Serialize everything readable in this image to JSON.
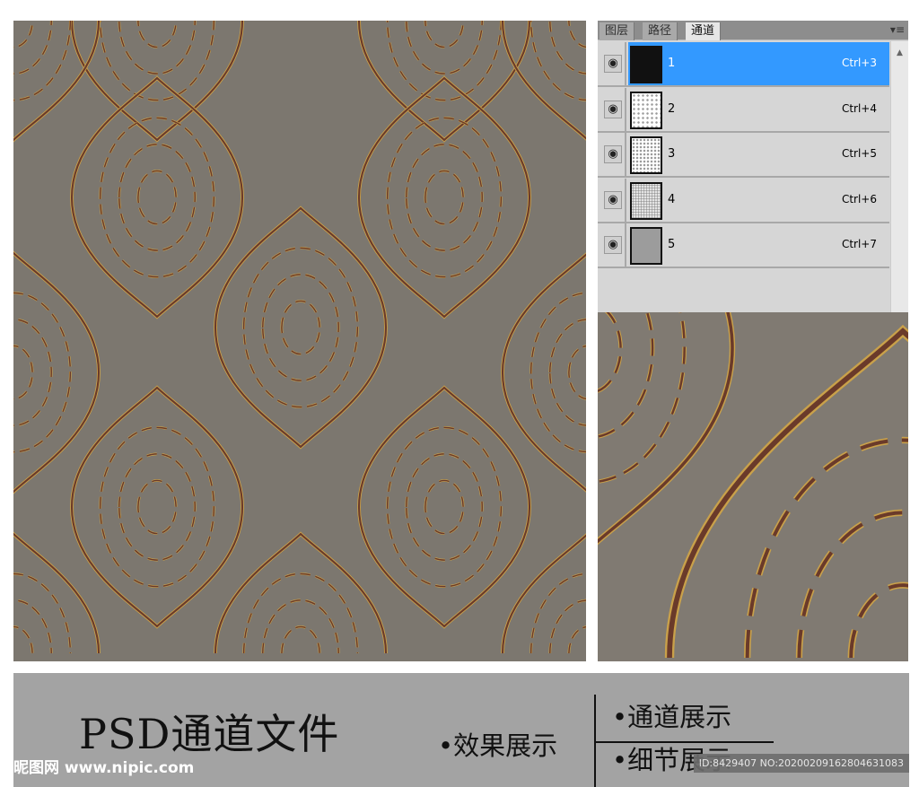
{
  "panel": {
    "tabs": [
      "图层",
      "路径",
      "通道"
    ],
    "active_tab": "通道",
    "menu_icon": "panel-menu-icon",
    "channels": [
      {
        "name": "1",
        "shortcut": "Ctrl+3",
        "selected": true
      },
      {
        "name": "2",
        "shortcut": "Ctrl+4",
        "selected": false
      },
      {
        "name": "3",
        "shortcut": "Ctrl+5",
        "selected": false
      },
      {
        "name": "4",
        "shortcut": "Ctrl+6",
        "selected": false
      },
      {
        "name": "5",
        "shortcut": "Ctrl+7",
        "selected": false
      }
    ]
  },
  "banner": {
    "title": "PSD通道文件",
    "effect": "•效果展示",
    "channel": "•通道展示",
    "detail": "•细节展示",
    "logo": "昵图网 www.nipic.com",
    "id": "ID:8429407 NO:20200209162804631083"
  },
  "colors": {
    "bg": "#7c776f",
    "motif": "#6a3a2a",
    "gold": "#c9a14a",
    "selected": "#3399ff"
  }
}
